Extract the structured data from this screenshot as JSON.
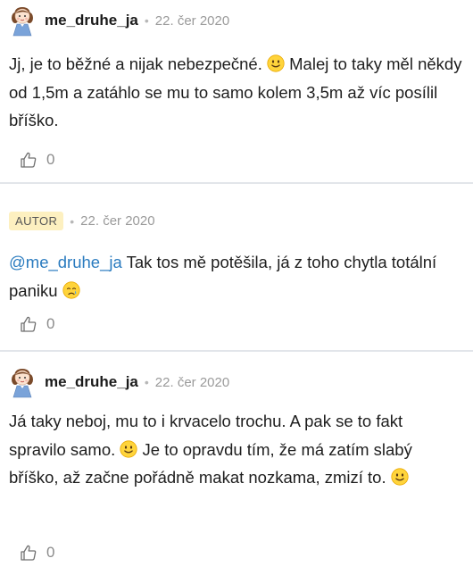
{
  "comments": [
    {
      "username": "me_druhe_ja",
      "date": "22. čer 2020",
      "text_a": "Jj, je to běžné a nijak nebezpečné.",
      "text_b": "Malej to taky měl někdy od 1,5m a zatáhlo se mu to samo kolem 3,5m až víc posílil bříško.",
      "like_count": "0"
    },
    {
      "badge": "AUTOR",
      "date": "22. čer 2020",
      "mention": "@me_druhe_ja",
      "text_a": " Tak tos mě potěšila, já z toho chytla totální paniku",
      "like_count": "0"
    },
    {
      "username": "me_druhe_ja",
      "date": "22. čer 2020",
      "text_a": "Já taky neboj, mu to i krvacelo trochu. A pak se to fakt spravilo samo.",
      "text_b": "Je to opravdu tím, že má zatím slabý bříško, až začne pořádně makat nozkama, zmizí to.",
      "like_count": "0"
    }
  ],
  "separator": "•",
  "icons": {
    "smile": "slightly-smiling-face-emoji",
    "cry": "crying-face-emoji",
    "like": "thumbs-up-icon",
    "avatar": "doll-avatar"
  },
  "colors": {
    "mention": "#2a7bbf",
    "badge_bg": "#fdf0c0",
    "divider": "#e2e5ea",
    "date": "#9a9a9a"
  }
}
